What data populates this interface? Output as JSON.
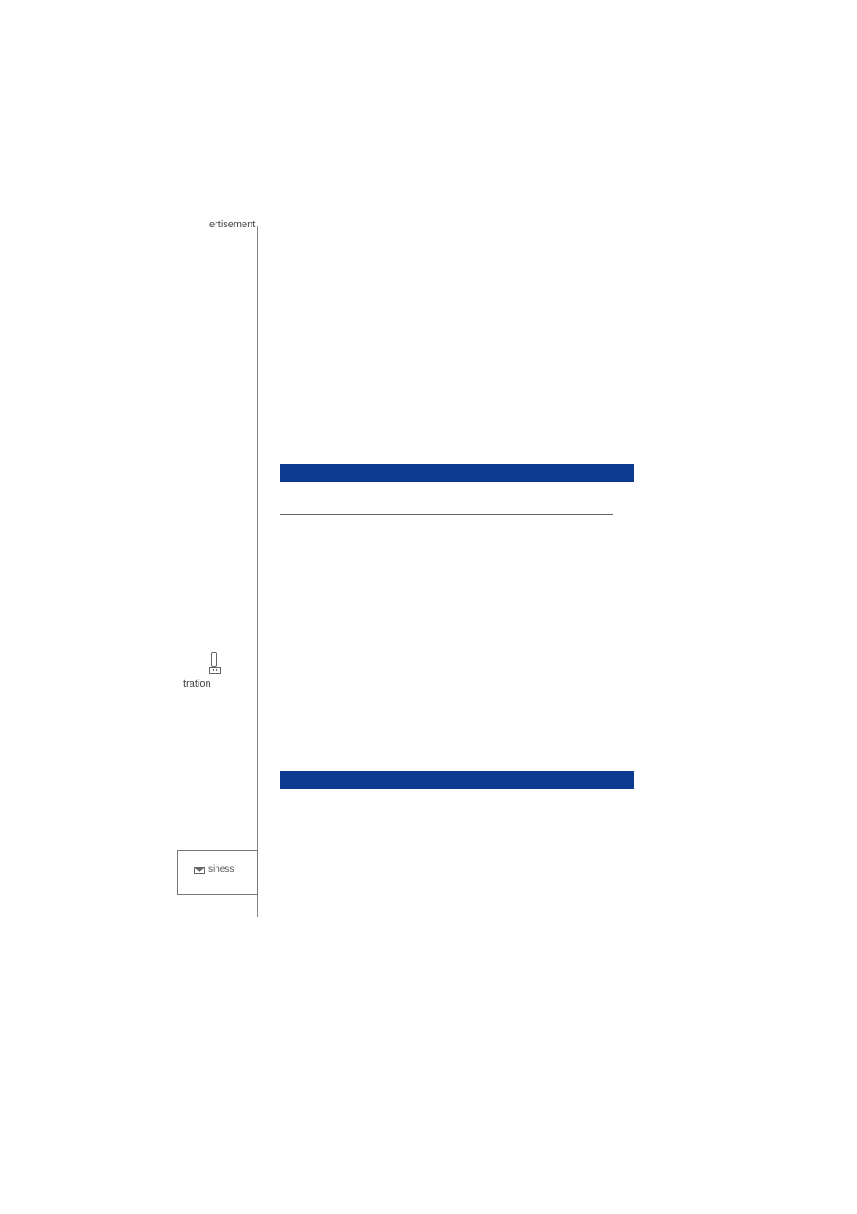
{
  "bracket_label": "ertisement",
  "reg_label": "tration",
  "box_label": "siness"
}
